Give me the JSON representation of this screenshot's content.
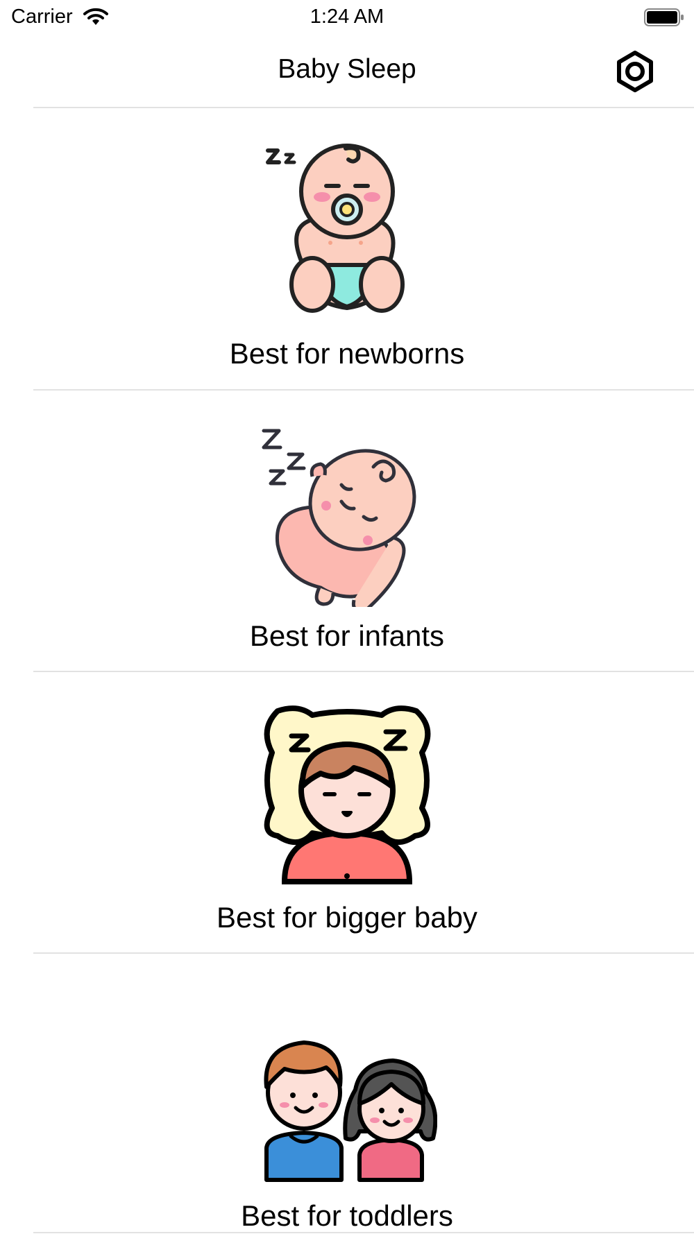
{
  "status_bar": {
    "carrier": "Carrier",
    "time": "1:24 AM"
  },
  "nav": {
    "title": "Baby Sleep",
    "settings_icon": "gear-icon"
  },
  "rows": [
    {
      "label": "Best for newborns",
      "icon": "sleeping-newborn-icon"
    },
    {
      "label": "Best for infants",
      "icon": "sleeping-infant-icon"
    },
    {
      "label": "Best for bigger baby",
      "icon": "child-on-pillow-icon"
    },
    {
      "label": "Best for toddlers",
      "icon": "toddlers-icon"
    }
  ],
  "colors": {
    "skin": "#fccfc0",
    "cheek": "#f58fab",
    "diaper": "#8eeadf",
    "pillow": "#fff7c9",
    "hair_brown": "#c98360",
    "shirt_red": "#ff7773",
    "shirt_blue": "#3b8fd9",
    "shirt_pink": "#f06a84",
    "hair_dark": "#545454",
    "outline": "#222"
  }
}
